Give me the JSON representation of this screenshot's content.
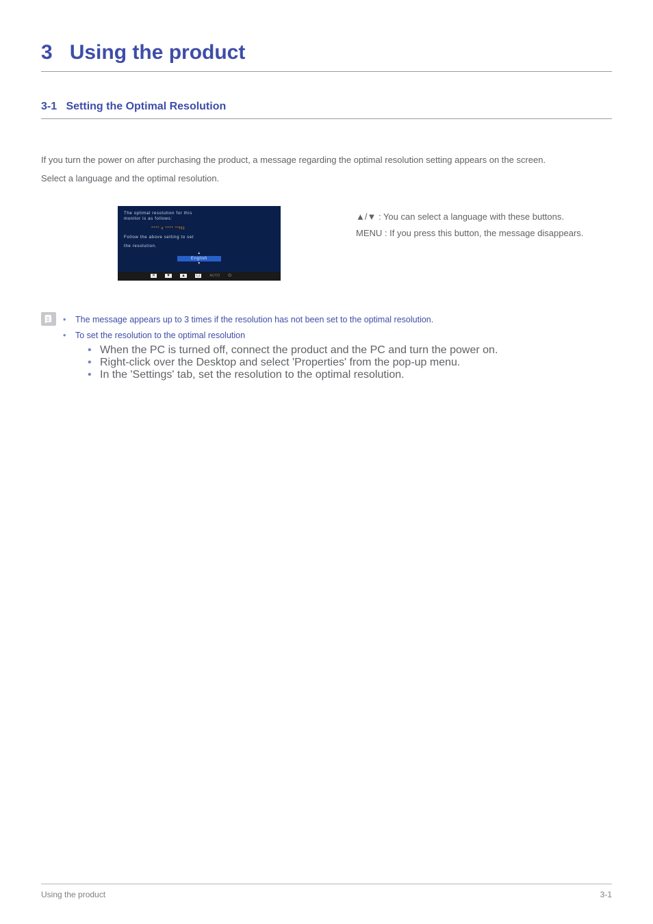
{
  "chapter": {
    "number": "3",
    "title": "Using the product"
  },
  "section": {
    "number": "3-1",
    "title": "Setting the Optimal Resolution"
  },
  "intro": {
    "p1": "If you turn the power on after purchasing the product, a message regarding the optimal resolution setting appears on the screen.",
    "p2": "Select a language and the optimal resolution."
  },
  "osd": {
    "line1a": "The optimal resolution for this",
    "line1b": "monitor is as follows:",
    "resolution": "**** x **** **Hz",
    "line2a": "Follow the above setting to set",
    "line2b": "the resolution.",
    "language": "English",
    "bezel": {
      "b1": "✕",
      "b2": "▼",
      "b3": "▲",
      "b4": "☐",
      "b5": "AUTO",
      "b6": "⏻"
    }
  },
  "right": {
    "line1": "▲/▼ : You can select a language with these buttons.",
    "line2": "MENU : If you press this button, the message disappears."
  },
  "notes": {
    "n1": "The message appears up to 3 times if the resolution has not been set to the optimal resolution.",
    "n2": "To set the resolution to the optimal resolution",
    "n2a": "When the PC is turned off, connect the product and the PC and turn the power on.",
    "n2b": "Right-click over the Desktop and select 'Properties' from the pop-up menu.",
    "n2c": "In the 'Settings' tab, set the resolution to the optimal resolution."
  },
  "footer": {
    "left": "Using the product",
    "right": "3-1"
  }
}
